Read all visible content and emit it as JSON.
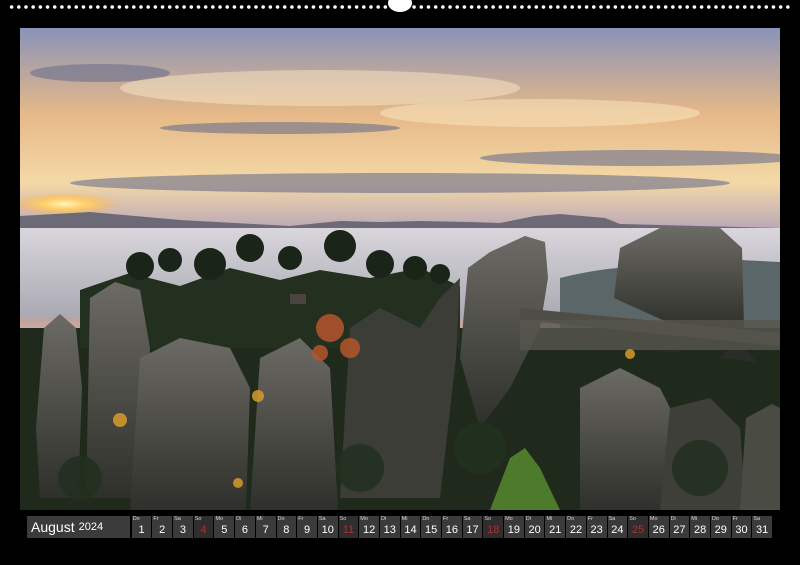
{
  "calendar": {
    "month": "August",
    "year": "2024",
    "days": [
      {
        "wd": "Do",
        "d": "1",
        "sun": false
      },
      {
        "wd": "Fr",
        "d": "2",
        "sun": false
      },
      {
        "wd": "Sa",
        "d": "3",
        "sun": false
      },
      {
        "wd": "So",
        "d": "4",
        "sun": true
      },
      {
        "wd": "Mo",
        "d": "5",
        "sun": false
      },
      {
        "wd": "Di",
        "d": "6",
        "sun": false
      },
      {
        "wd": "Mi",
        "d": "7",
        "sun": false
      },
      {
        "wd": "Do",
        "d": "8",
        "sun": false
      },
      {
        "wd": "Fr",
        "d": "9",
        "sun": false
      },
      {
        "wd": "Sa",
        "d": "10",
        "sun": false
      },
      {
        "wd": "So",
        "d": "11",
        "sun": true
      },
      {
        "wd": "Mo",
        "d": "12",
        "sun": false
      },
      {
        "wd": "Di",
        "d": "13",
        "sun": false
      },
      {
        "wd": "Mi",
        "d": "14",
        "sun": false
      },
      {
        "wd": "Do",
        "d": "15",
        "sun": false
      },
      {
        "wd": "Fr",
        "d": "16",
        "sun": false
      },
      {
        "wd": "Sa",
        "d": "17",
        "sun": false
      },
      {
        "wd": "So",
        "d": "18",
        "sun": true
      },
      {
        "wd": "Mo",
        "d": "19",
        "sun": false
      },
      {
        "wd": "Di",
        "d": "20",
        "sun": false
      },
      {
        "wd": "Mi",
        "d": "21",
        "sun": false
      },
      {
        "wd": "Do",
        "d": "22",
        "sun": false
      },
      {
        "wd": "Fr",
        "d": "23",
        "sun": false
      },
      {
        "wd": "Sa",
        "d": "24",
        "sun": false
      },
      {
        "wd": "So",
        "d": "25",
        "sun": true
      },
      {
        "wd": "Mo",
        "d": "26",
        "sun": false
      },
      {
        "wd": "Di",
        "d": "27",
        "sun": false
      },
      {
        "wd": "Mi",
        "d": "28",
        "sun": false
      },
      {
        "wd": "Do",
        "d": "29",
        "sun": false
      },
      {
        "wd": "Fr",
        "d": "30",
        "sun": false
      },
      {
        "wd": "Sa",
        "d": "31",
        "sun": false
      }
    ]
  },
  "colors": {
    "background": "#000000",
    "cell": "#3b3b3b",
    "sunday_text": "#b03030"
  }
}
